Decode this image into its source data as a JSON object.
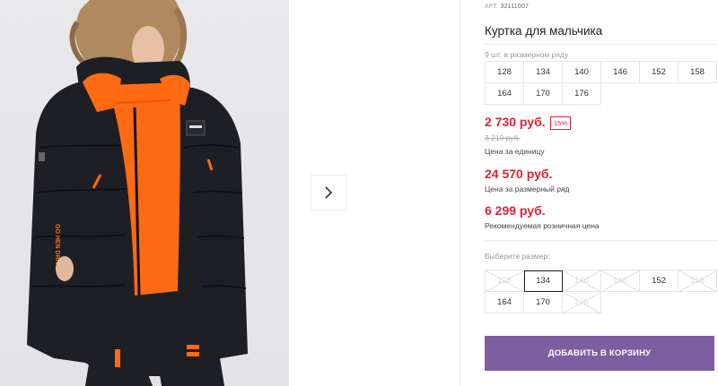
{
  "product": {
    "art_label": "АРТ.",
    "art_code": "32111007",
    "title": "Куртка для мальчика",
    "size_range_note": "9 шт. в размерном ряду",
    "size_range": [
      "128",
      "134",
      "140",
      "146",
      "152",
      "158",
      "164",
      "170",
      "176"
    ],
    "price": "2 730 руб.",
    "discount": "15%",
    "old_price": "3 210 руб.",
    "price_unit_label": "Цена за единицу",
    "range_price": "24 570 руб.",
    "range_price_label": "Цена за размерный ряд",
    "retail_price": "6 299 руб.",
    "retail_price_label": "Рекомендуемая розничная цена",
    "choose_size_label": "Выберите размер:",
    "sizes": [
      {
        "label": "128",
        "available": false,
        "selected": false
      },
      {
        "label": "134",
        "available": true,
        "selected": true
      },
      {
        "label": "140",
        "available": false,
        "selected": false
      },
      {
        "label": "146",
        "available": false,
        "selected": false
      },
      {
        "label": "152",
        "available": true,
        "selected": false
      },
      {
        "label": "158",
        "available": false,
        "selected": false
      },
      {
        "label": "164",
        "available": true,
        "selected": false
      },
      {
        "label": "170",
        "available": true,
        "selected": false
      },
      {
        "label": "176",
        "available": false,
        "selected": false
      }
    ],
    "add_to_cart": "Добавить в корзину"
  },
  "gallery": {
    "next_icon": "chevron-right-icon",
    "jacket_print": "GO HEN DRIVE"
  },
  "colors": {
    "accent_red": "#d62538",
    "button_purple": "#7d5ea0",
    "jacket": "#1e1f24",
    "orange": "#ff6a13"
  }
}
